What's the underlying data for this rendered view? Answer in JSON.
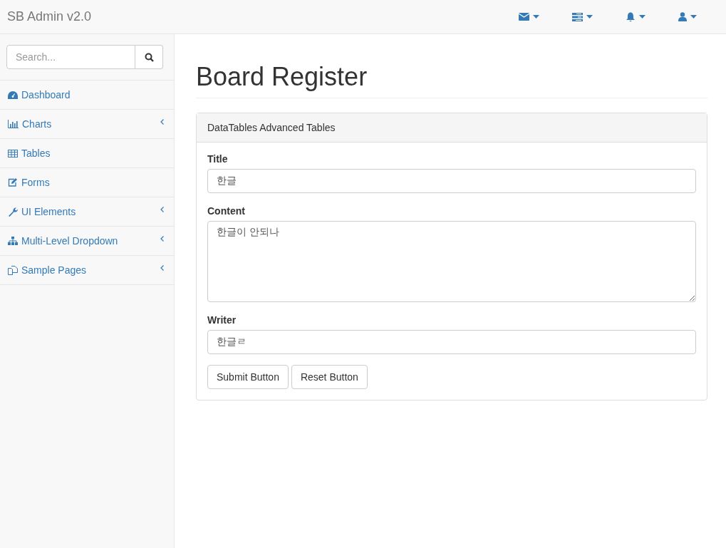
{
  "brand": "SB Admin v2.0",
  "nav_icons": [
    {
      "kind": "envelope"
    },
    {
      "kind": "tasks"
    },
    {
      "kind": "bell"
    },
    {
      "kind": "user"
    }
  ],
  "sidebar": {
    "search": {
      "placeholder": "Search..."
    },
    "items": [
      {
        "label": "Dashboard",
        "kind": "dashboard",
        "has_submenu": false
      },
      {
        "label": "Charts",
        "kind": "chart",
        "has_submenu": true
      },
      {
        "label": "Tables",
        "kind": "table",
        "has_submenu": false
      },
      {
        "label": "Forms",
        "kind": "edit",
        "has_submenu": false
      },
      {
        "label": "UI Elements",
        "kind": "wrench",
        "has_submenu": true
      },
      {
        "label": "Multi-Level Dropdown",
        "kind": "sitemap",
        "has_submenu": true
      },
      {
        "label": "Sample Pages",
        "kind": "files",
        "has_submenu": true
      }
    ]
  },
  "page_title": "Board Register",
  "panel": {
    "heading": "DataTables Advanced Tables",
    "fields": [
      {
        "label": "Title",
        "kind": "input",
        "value": "한글"
      },
      {
        "label": "Content",
        "kind": "textarea",
        "value": "한글이 안되나"
      },
      {
        "label": "Writer",
        "kind": "input",
        "value": "한글ㄹ"
      }
    ],
    "buttons": [
      "Submit Button",
      "Reset Button"
    ]
  }
}
